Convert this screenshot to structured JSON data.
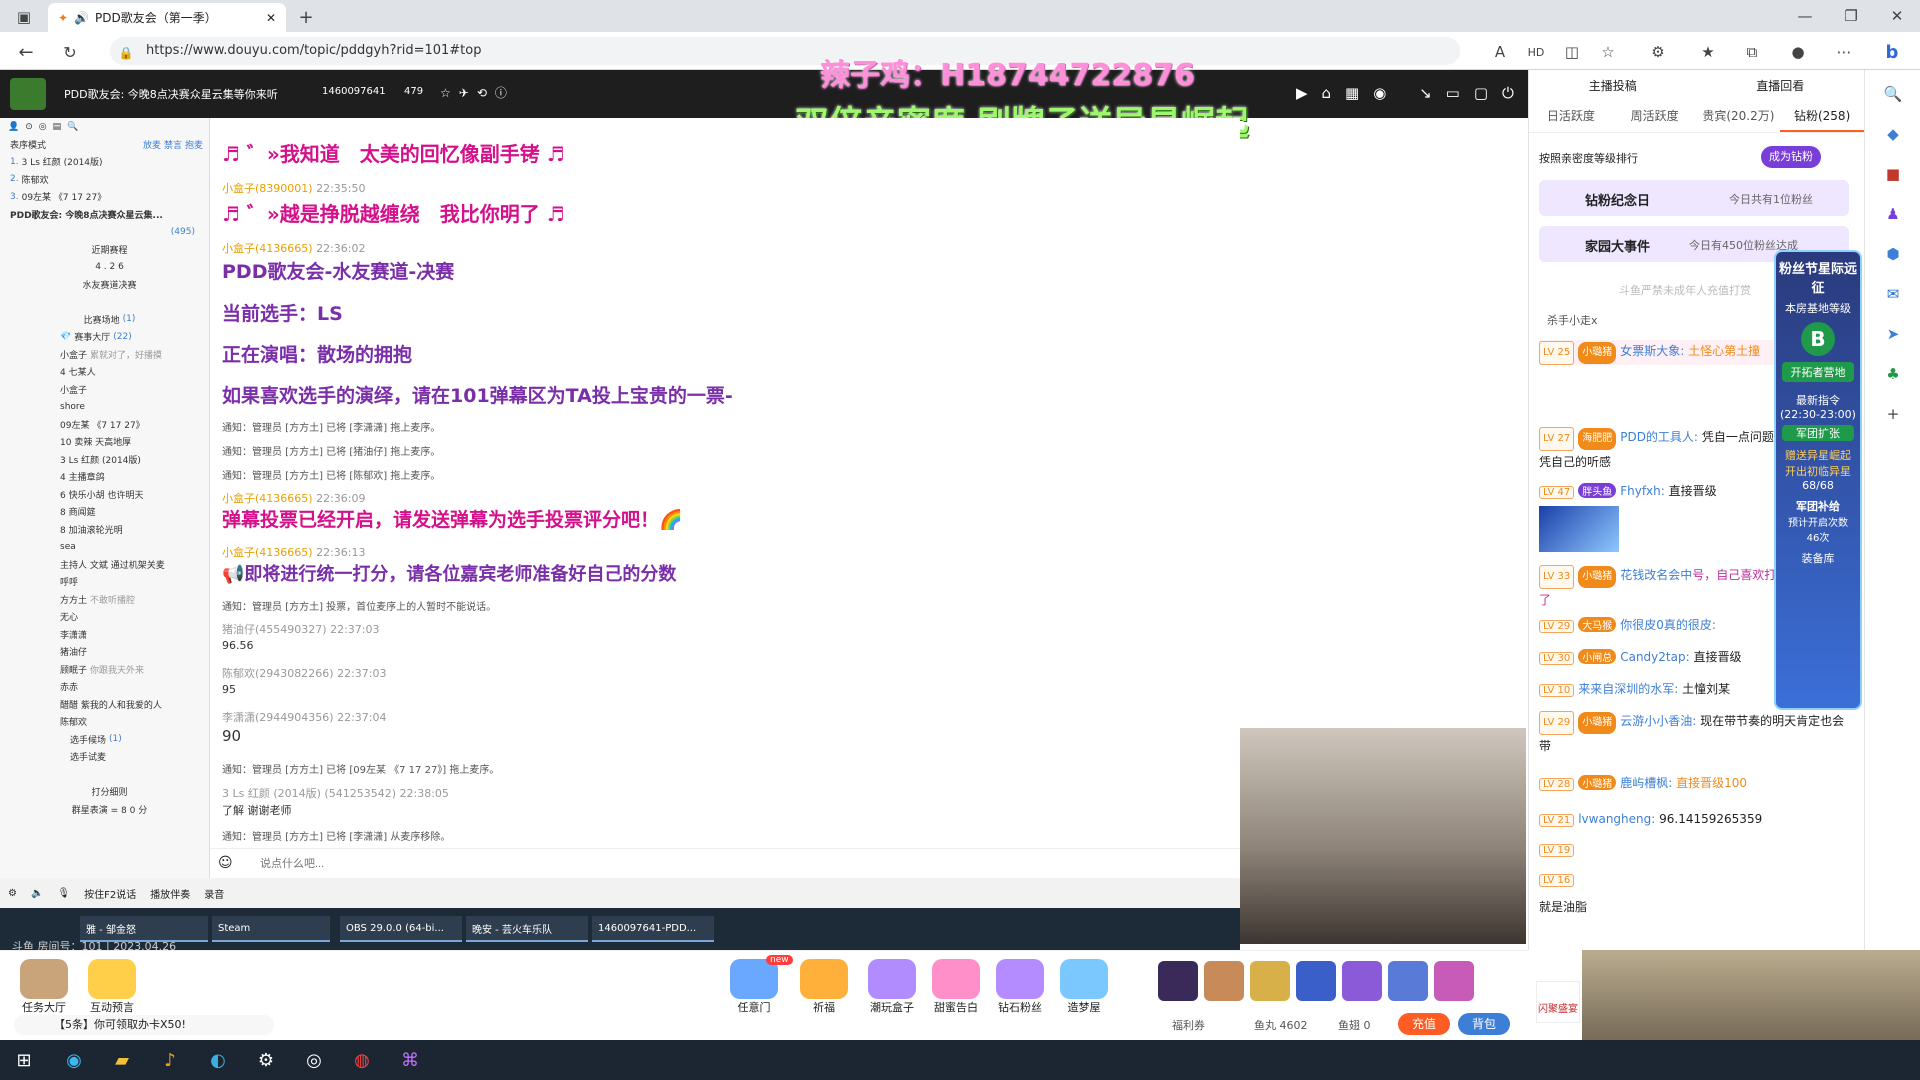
{
  "browser": {
    "tab_title": "PDD歌友会（第一季）",
    "url": "https://www.douyu.com/topic/pddgyh?rid=101#top"
  },
  "overlay": {
    "line1": "辣子鸡：H18744722876",
    "line2": "双倍亲密度 刷牌子送异星崛起"
  },
  "stream": {
    "title": "PDD歌友会: 今晚8点决赛众星云集等你来听",
    "room_id": "1460097641",
    "viewers": "479"
  },
  "left_panel": {
    "header": "表序模式",
    "header_links": [
      "放麦",
      "禁言",
      "抱麦"
    ],
    "top": [
      {
        "rank": "1.",
        "name": "3 Ls 红颜 (2014版)"
      },
      {
        "rank": "2.",
        "name": "陈郁欢"
      },
      {
        "rank": "3.",
        "name": "09左某 《7 17 27》"
      }
    ],
    "channel_title": "PDD歌友会: 今晚8点决赛众星云集...",
    "channel_count": "(495)",
    "schedule_title": "近期赛程",
    "schedule_date": "4 . 2 6",
    "schedule_event": "水友赛道决赛",
    "venue_title": "比赛场地",
    "venue_count": "(1)",
    "hall": "赛事大厅",
    "hall_count": "(22)",
    "users": [
      "小盒子",
      "4 七某人",
      "小盒子",
      "shore",
      "09左某 《7 17 27》",
      "10 卖辣 天高地厚",
      "3 Ls 红颜 (2014版)",
      "4 主播章鸽",
      "6 快乐小胡 也许明天",
      "8 商闻筵",
      "8 加油滚轮光明",
      "sea",
      "主持人 文斌 通过机架关麦",
      "呼呼",
      "方方土",
      "无心",
      "李潇潇",
      "猪油仔",
      "顾眠子",
      "赤赤",
      "醋醋 紫我的人和我爱的人",
      "陈郁欢"
    ],
    "user_notes": {
      "u1": "累就对了，好播摸",
      "u14": "不敢听播腔",
      "u19": "你跟我天外来"
    },
    "sub1": "选手候场",
    "sub1_count": "(1)",
    "sub2": "选手试麦",
    "score_title": "打分细则",
    "score_rule": "群星表演 = 8 0 分"
  },
  "chat": {
    "messages": [
      {
        "type": "big",
        "text": "♬ ゛»我知道　太美的回忆像副手铐 ♬"
      },
      {
        "type": "meta",
        "name": "小盒子(8390001)",
        "time": "22:35:50"
      },
      {
        "type": "big",
        "text": "♬ ゛»越是挣脱越缠绕　我比你明了 ♬"
      },
      {
        "type": "meta",
        "name": "小盒子(4136665)",
        "time": "22:36:02"
      },
      {
        "type": "big2",
        "text": "PDD歌友会-水友赛道-决赛"
      },
      {
        "type": "big2",
        "text": "当前选手：LS"
      },
      {
        "type": "big2",
        "text": "正在演唱：散场的拥抱"
      },
      {
        "type": "big2",
        "text": "如果喜欢选手的演绎，请在101弹幕区为TA投上宝贵的一票-"
      },
      {
        "type": "notice",
        "text": "通知：管理员 [方方土] 已将 [李潇潇] 拖上麦序。"
      },
      {
        "type": "notice",
        "text": "通知：管理员 [方方土] 已将 [猪油仔] 拖上麦序。"
      },
      {
        "type": "notice",
        "text": "通知：管理员 [方方土] 已将 [陈郁欢] 拖上麦序。"
      },
      {
        "type": "meta",
        "name": "小盒子(4136665)",
        "time": "22:36:09"
      },
      {
        "type": "big",
        "text": "弹幕投票已经开启，请发送弹幕为选手投票评分吧！🌈"
      },
      {
        "type": "meta",
        "name": "小盒子(4136665)",
        "time": "22:36:13"
      },
      {
        "type": "big",
        "text": "📢即将进行统一打分，请各位嘉宾老师准备好自己的分数"
      },
      {
        "type": "notice",
        "text": "通知：管理员 [方方土] 投票，首位麦序上的人暂时不能说话。"
      },
      {
        "type": "meta2",
        "name": "猪油仔(455490327)",
        "time": "22:37:03"
      },
      {
        "type": "plain",
        "text": "96.56"
      },
      {
        "type": "meta2",
        "name": "陈郁欢(2943082266)",
        "time": "22:37:03"
      },
      {
        "type": "plain",
        "text": "95"
      },
      {
        "type": "meta2",
        "name": "李潇潇(2944904356)",
        "time": "22:37:04"
      },
      {
        "type": "plain_big",
        "text": "90"
      },
      {
        "type": "notice",
        "text": "通知：管理员 [方方土] 已将 [09左某 《7 17 27》] 拖上麦序。"
      },
      {
        "type": "meta2",
        "name": "3 Ls 红颜 (2014版) (541253542)",
        "time": "22:38:05"
      },
      {
        "type": "plain",
        "text": "了解 谢谢老师"
      },
      {
        "type": "notice",
        "text": "通知：管理员 [方方土] 已将 [李潇潇] 从麦序移除。"
      }
    ],
    "input_placeholder": "说点什么吧..."
  },
  "bottom_controls": {
    "ptt": "按住F2说话",
    "play": "播放伴奏",
    "record": "录音"
  },
  "stream_taskbar": {
    "room_line": "斗鱼 房间号：101 | 2023.04.26",
    "apps": [
      "雅 - 邹金怒",
      "Steam",
      "OBS 29.0.0 (64-bi...",
      "晚安 - 芸火车乐队",
      "1460097641-PDD..."
    ]
  },
  "right_panel": {
    "top_links": [
      "主播投稿",
      "直播回看"
    ],
    "tabs": [
      "日活跃度",
      "周活跃度",
      "贵宾(20.2万)",
      "钻粉(258)"
    ],
    "rank_label": "按照亲密度等级排行",
    "become_btn": "成为钻粉",
    "banner1_title": "钻粉纪念日",
    "banner1_right": "今日共有1位粉丝",
    "banner2_title": "家园大事件",
    "banner2_right": "今日有450位粉丝达成",
    "notice": "斗鱼严禁未成年人充值打赏",
    "rank1": "杀手小走x",
    "messages": [
      {
        "lv": "LV 25",
        "badge": "小璐猪",
        "name": "女票斯大象:",
        "text": "土怪心第土撞"
      },
      {
        "lv": "LV 27",
        "badge": "海肥肥",
        "name": "PDD的工具人:",
        "text": "凭自一点问题，水友还不是凭自己的听感"
      },
      {
        "lv": "LV 47",
        "badge": "胖头鱼",
        "name": "Fhyfxh:",
        "text": "直接晋级"
      },
      {
        "lv": "LV 33",
        "badge": "小璐猪",
        "name": "花钱改名会中",
        "text": "号，自己喜欢打自己的分就好了"
      },
      {
        "lv": "LV 29",
        "badge": "大马猴",
        "name": "你很皮0真的很皮:",
        "text": ""
      },
      {
        "lv": "LV 30",
        "badge": "小闸总",
        "name": "Candy2tap:",
        "text": "直接晋级"
      },
      {
        "lv": "LV 10",
        "badge": "",
        "name": "来来自深圳的水军:",
        "text": "土憧刘某"
      },
      {
        "lv": "LV 29",
        "badge": "小璐猪",
        "name": "云游小小香油:",
        "text": "现在带节奏的明天肯定也会带"
      },
      {
        "lv": "LV 28",
        "badge": "小璐猪",
        "name": "鹿屿槽枫:",
        "text": "直接晋级100"
      },
      {
        "lv": "LV 21",
        "badge": "",
        "name": "lvwangheng:",
        "text": "96.14159265359"
      },
      {
        "lv": "LV 19",
        "badge": "",
        "name": "",
        "text": ""
      },
      {
        "lv": "LV 16",
        "badge": "",
        "name": "",
        "text": "就是油脂"
      }
    ]
  },
  "event_overlay": {
    "title": "粉丝节星际远征",
    "sub": "本房基地等级",
    "grade": "B",
    "btn": "开拓者营地",
    "cmd_title": "最新指令",
    "cmd_time": "(22:30-23:00)",
    "cmd_action": "军团扩张",
    "gift_text": "赠送异星崛起开出初临异星",
    "progress": "68/68",
    "supply": "军团补给",
    "expect": "预计开启次数",
    "times": "46次",
    "supply2": "装备库"
  },
  "gift_bar": {
    "left_items": [
      "任务大厅",
      "互动预言"
    ],
    "center_items": [
      "任意门",
      "祈福",
      "潮玩盒子",
      "甜蜜告白",
      "钻石粉丝",
      "造梦屋"
    ],
    "new_badge": "new",
    "tip": "【5条】你可领取办卡X50!",
    "welfare": "福利券",
    "fishball": "鱼丸 4602",
    "fishfin": "鱼翅 0",
    "recharge": "充值",
    "backpack": "背包",
    "side_label": "闪聚盛宴"
  },
  "colors": {
    "accent": "#ff5d23",
    "purple": "#7a2ea8",
    "magenta": "#d4108b"
  }
}
